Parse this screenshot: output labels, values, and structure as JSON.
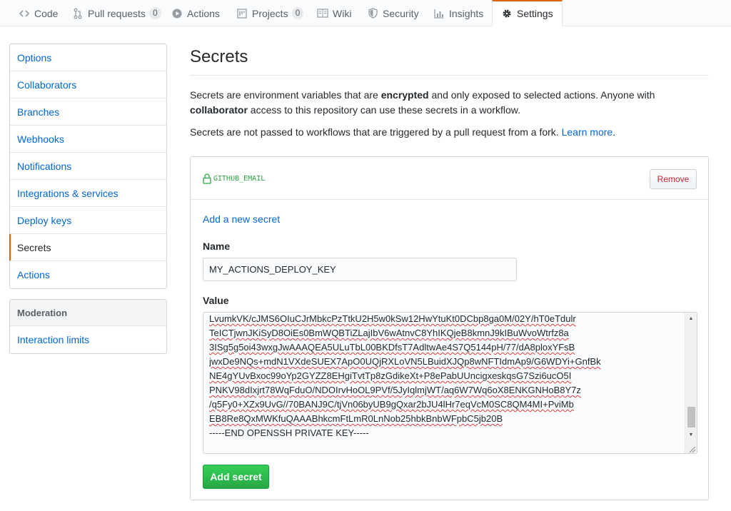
{
  "tabs": [
    {
      "label": "Code",
      "icon": "code-icon"
    },
    {
      "label": "Pull requests",
      "icon": "git-pull-request-icon",
      "count": "0"
    },
    {
      "label": "Actions",
      "icon": "play-icon"
    },
    {
      "label": "Projects",
      "icon": "project-icon",
      "count": "0"
    },
    {
      "label": "Wiki",
      "icon": "book-icon"
    },
    {
      "label": "Security",
      "icon": "shield-icon"
    },
    {
      "label": "Insights",
      "icon": "graph-icon"
    },
    {
      "label": "Settings",
      "icon": "gear-icon",
      "selected": true
    }
  ],
  "sidebar": {
    "items": [
      {
        "label": "Options"
      },
      {
        "label": "Collaborators"
      },
      {
        "label": "Branches"
      },
      {
        "label": "Webhooks"
      },
      {
        "label": "Notifications"
      },
      {
        "label": "Integrations & services"
      },
      {
        "label": "Deploy keys"
      },
      {
        "label": "Secrets",
        "selected": true
      },
      {
        "label": "Actions"
      }
    ],
    "moderation": {
      "heading": "Moderation",
      "items": [
        {
          "label": "Interaction limits"
        }
      ]
    }
  },
  "main": {
    "title": "Secrets",
    "desc1": {
      "p1": "Secrets are environment variables that are ",
      "b1": "encrypted",
      "p2": " and only exposed to selected actions. Anyone with ",
      "b2": "collaborator",
      "p3": " access to this repository can use these secrets in a workflow."
    },
    "desc2": {
      "text": "Secrets are not passed to workflows that are triggered by a pull request from a fork. ",
      "link": "Learn more",
      "end": "."
    },
    "existing_secret": {
      "name": "GITHUB_EMAIL",
      "remove_label": "Remove"
    },
    "add_link": "Add a new secret",
    "name_label": "Name",
    "name_value": "MY_ACTIONS_DEPLOY_KEY",
    "value_label": "Value",
    "value_lines": [
      "LvumkVK/cJMS6OIuCJrMbkcPzTtkU2H5w0kSw12HwYtuKt0DCbp8ga0M/02Y/hT0eTdulr",
      "TeICTjwnJKiSyD8OiEs0BmWQBTiZLajIbV6wAtnvC8YhIKQjeB8kmnJ9kIBuWvoWtrfz8a",
      "3ISg5g5oi43wxgJwAAAQEA5ULuTbL00BKDfsT7AdltwAe4S7Q5144pH/77/dA8ploxYFsB",
      "jwxDe9NQs+mdN1VXdeSUEX7ApO0UQjRXLoVN5LBuidXJQp8wNFTIdmAp9/G6WDYi+GnfBk",
      "NE4gYUvBxoc99oYp2GYZZ8EHgiTvtTp8zGdikeXt+P8ePabUUncigxeskqsG7Szi6ucO5I",
      "PNKV98dIxjrt78WqFduO/NDOIrvHoOL9PVf/5JyIqlmjWT/aq6W7Wq6oX8ENKGNHoB8Y7z",
      "/q5Fy0+XZx9UvG//70BANJ9C/tjVn06byUB9gQxar2bJU4lHr7eqVcM0SC8QM4MI+PviMb",
      "EB8Re8QxMWKfuQAAABhkcmFtLmR0LnNob25hbkBnbWFpbC5jb20B",
      "-----END OPENSSH PRIVATE KEY-----"
    ],
    "submit_label": "Add secret"
  },
  "colors": {
    "link": "#0366d6",
    "accent": "#e36209",
    "success": "#28a745",
    "danger": "#cb2431"
  }
}
